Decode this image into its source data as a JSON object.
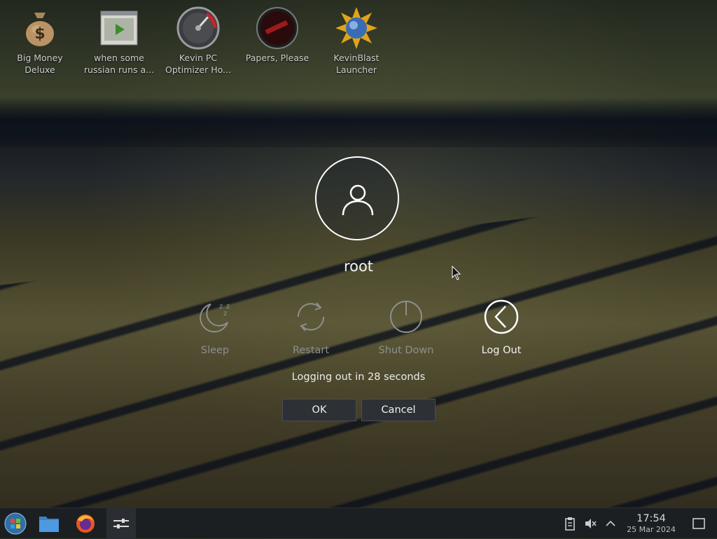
{
  "desktop": {
    "icons": [
      {
        "label": "Big Money Deluxe",
        "icon": "money-bag-icon"
      },
      {
        "label": "when some russian runs a...",
        "icon": "video-file-icon"
      },
      {
        "label": "Kevin PC Optimizer Ho...",
        "icon": "speedometer-icon"
      },
      {
        "label": "Papers, Please",
        "icon": "papers-please-icon"
      },
      {
        "label": "KevinBlast Launcher",
        "icon": "kevinblast-icon"
      }
    ]
  },
  "logout_dialog": {
    "username": "root",
    "actions": [
      {
        "label": "Sleep",
        "icon": "sleep-icon",
        "active": false
      },
      {
        "label": "Restart",
        "icon": "restart-icon",
        "active": false
      },
      {
        "label": "Shut Down",
        "icon": "shutdown-icon",
        "active": false
      },
      {
        "label": "Log Out",
        "icon": "logout-icon",
        "active": true
      }
    ],
    "countdown_text": "Logging out in 28 seconds",
    "ok_label": "OK",
    "cancel_label": "Cancel"
  },
  "taskbar": {
    "launchers": [
      "start-menu-icon",
      "file-manager-icon",
      "firefox-icon",
      "system-settings-icon"
    ],
    "tray": [
      "clipboard-icon",
      "volume-muted-icon",
      "tray-expand-icon"
    ],
    "clock": {
      "time": "17:54",
      "date": "25 Mar 2024"
    },
    "show_desktop": "show-desktop-icon"
  },
  "colors": {
    "accent": "#ffffff",
    "inactive": "#8d8f8d",
    "taskbar": "#1c1f22"
  }
}
